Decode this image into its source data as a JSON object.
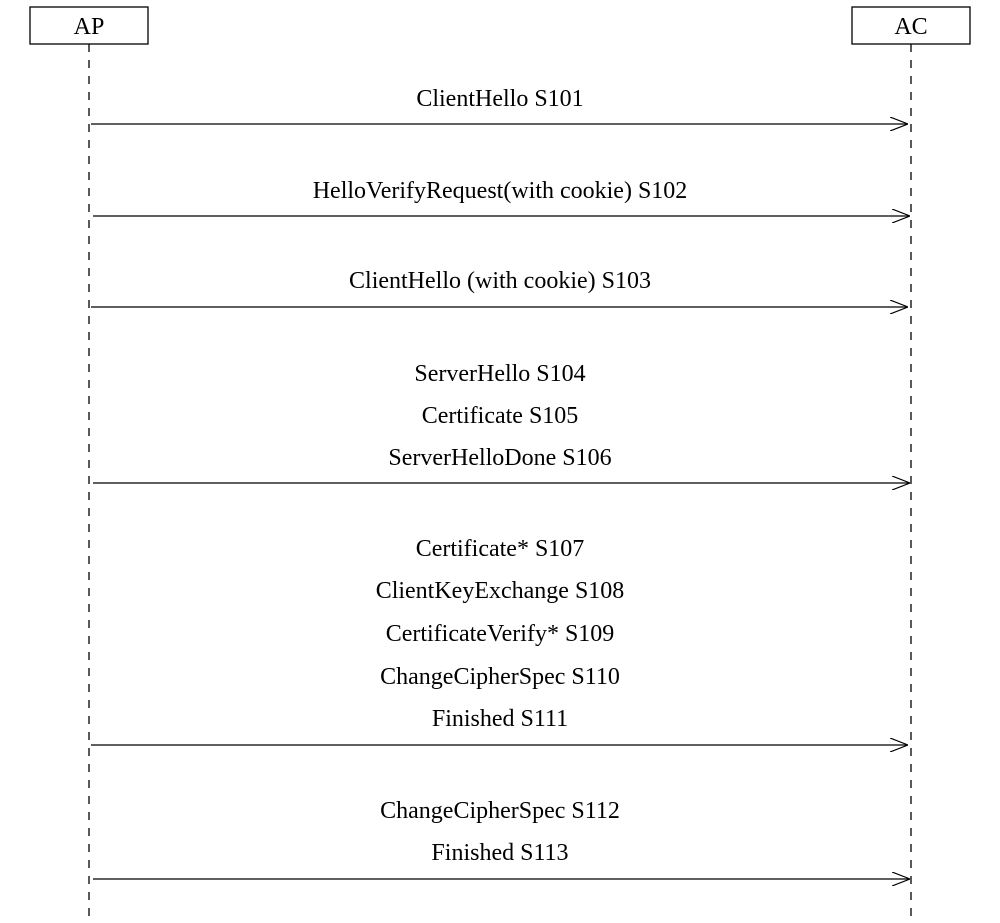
{
  "actors": {
    "left": "AP",
    "right": "AC"
  },
  "messages": {
    "m1_l1": "ClientHello S101",
    "m2_l1": "HelloVerifyRequest(with cookie) S102",
    "m3_l1": "ClientHello (with cookie) S103",
    "m4_l1": "ServerHello S104",
    "m4_l2": "Certificate S105",
    "m4_l3": "ServerHelloDone S106",
    "m5_l1": "Certificate* S107",
    "m5_l2": "ClientKeyExchange S108",
    "m5_l3": "CertificateVerify* S109",
    "m5_l4": "ChangeCipherSpec S110",
    "m5_l5": "Finished S111",
    "m6_l1": "ChangeCipherSpec S112",
    "m6_l2": "Finished S113"
  }
}
